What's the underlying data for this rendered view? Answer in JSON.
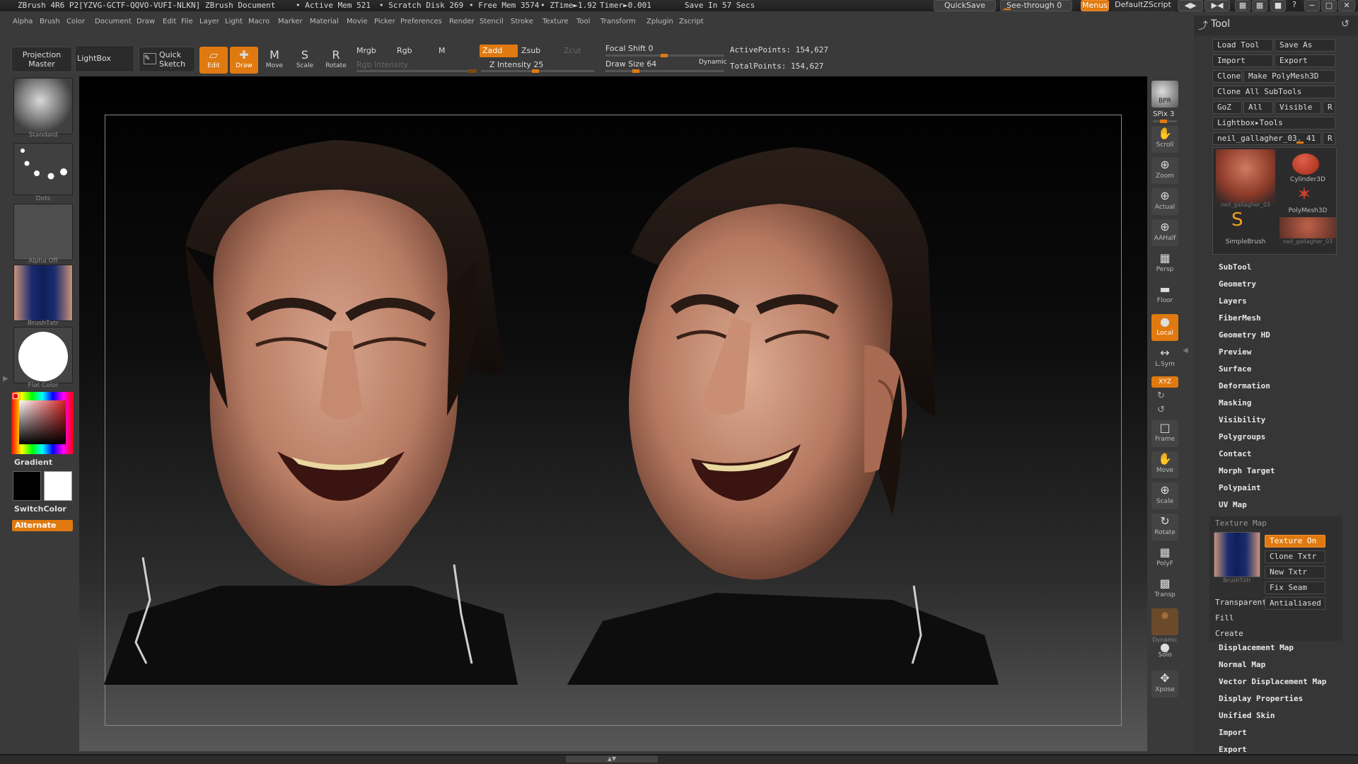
{
  "titlebar": {
    "app": "ZBrush 4R6 P2[YZVG-GCTF-QQVO-VUFI-NLKN]",
    "document": "ZBrush Document",
    "active_mem": "• Active Mem 521",
    "scratch_disk": "• Scratch Disk 269",
    "free_mem": "• Free Mem 3574",
    "ztime": "• ZTime►1.92",
    "timer": "Timer►0.001",
    "save_in": "Save In 57 Secs",
    "quicksave": "QuickSave",
    "see_through": "See-through",
    "see_through_value": "0",
    "menus": "Menus",
    "default_zscript": "DefaultZScript"
  },
  "menubar": [
    "Alpha",
    "Brush",
    "Color",
    "Document",
    "Draw",
    "Edit",
    "File",
    "Layer",
    "Light",
    "Macro",
    "Marker",
    "Material",
    "Movie",
    "Picker",
    "Preferences",
    "Render",
    "Stencil",
    "Stroke",
    "Texture",
    "Tool",
    "Transform",
    "Zplugin",
    "Zscript"
  ],
  "shelf": {
    "projection_master": "Projection Master",
    "lightbox": "LightBox",
    "quick_sketch": "Quick Sketch",
    "edit": "Edit",
    "draw": "Draw",
    "move": "Move",
    "scale": "Scale",
    "rotate": "Rotate",
    "mrgb": "Mrgb",
    "rgb": "Rgb",
    "m": "M",
    "rgb_intensity": "Rgb Intensity",
    "zadd": "Zadd",
    "zsub": "Zsub",
    "zcut": "Zcut",
    "z_intensity_label": "Z Intensity",
    "z_intensity": "25",
    "focal_shift_label": "Focal Shift",
    "focal_shift": "0",
    "draw_size_label": "Draw Size",
    "draw_size": "64",
    "dynamic": "Dynamic",
    "active_points": "ActivePoints: 154,627",
    "total_points": "TotalPoints: 154,627"
  },
  "leftbar": {
    "brush": "Standard",
    "stroke": "Dots",
    "alpha": "Alpha Off",
    "texture": "BrushTxtr",
    "material": "Flat Color",
    "gradient": "Gradient",
    "switchcolor": "SwitchColor",
    "alternate": "Alternate"
  },
  "rightnav": {
    "bpr": "BPR",
    "spix": "SPix 3",
    "scroll": "Scroll",
    "zoom": "Zoom",
    "actual": "Actual",
    "aahalf": "AAHalf",
    "persp": "Persp",
    "floor": "Floor",
    "local": "Local",
    "lsym": "L.Sym",
    "xyz": "XYZ",
    "frame": "Frame",
    "move": "Move",
    "scale": "Scale",
    "rotate": "Rotate",
    "polyf": "PolyF",
    "transp": "Transp",
    "dynamic": "Dynamic",
    "solo": "Solo",
    "xpose": "Xpose"
  },
  "toolpanel": {
    "title": "Tool",
    "load_tool": "Load Tool",
    "save_as": "Save As",
    "import": "Import",
    "export": "Export",
    "clone": "Clone",
    "make_polymesh": "Make PolyMesh3D",
    "clone_all_subtools": "Clone All SubTools",
    "goz": "GoZ",
    "all": "All",
    "visible": "Visible",
    "r": "R",
    "lightbox_tools": "Lightbox▸Tools",
    "current_tool": "neil_gallagher_03. 41",
    "tools": [
      {
        "name": "neil_gallagher_03"
      },
      {
        "name": "Cylinder3D"
      },
      {
        "name": "PolyMesh3D"
      },
      {
        "name": "SimpleBrush"
      },
      {
        "name": "neil_gallagher_03"
      }
    ],
    "menu_items": [
      "SubTool",
      "Geometry",
      "Layers",
      "FiberMesh",
      "Geometry HD",
      "Preview",
      "Surface",
      "Deformation",
      "Masking",
      "Visibility",
      "Polygroups",
      "Contact",
      "Morph Target",
      "Polypaint",
      "UV Map"
    ],
    "texture_map": "Texture Map",
    "texture_on": "Texture On",
    "clone_txtr": "Clone Txtr",
    "new_txtr": "New Txtr",
    "fix_seam": "Fix Seam",
    "tex_caption": "BrushTxtr",
    "transparent": "Transparent",
    "antialiased": "Antialiased",
    "fill": "Fill",
    "create": "Create",
    "menu_items_2": [
      "Displacement Map",
      "Normal Map",
      "Vector Displacement Map",
      "Display Properties",
      "Unified Skin",
      "Import",
      "Export"
    ]
  },
  "colors": {
    "accent": "#e07a10",
    "panel": "#363636",
    "dark": "#2b2b2b"
  }
}
